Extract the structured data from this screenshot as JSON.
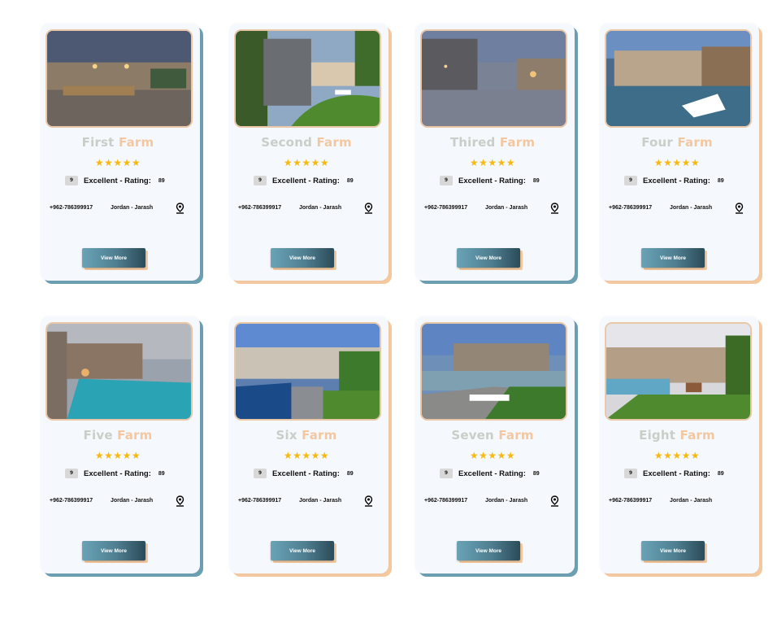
{
  "colors": {
    "shadow_blue": "#6c9fb2",
    "shadow_peach": "#f4c9a0",
    "title_gray": "#c9cec8",
    "title_accent": "#f2c8a2",
    "star_gold": "#f6b90f",
    "button_gradient": [
      "#6aa3b6",
      "#2b4b58"
    ]
  },
  "cards": [
    {
      "title_first": "First",
      "title_accent": "Farm",
      "stars": "★★★★★",
      "score": "9",
      "rating_label": "Excellent - Rating:",
      "rating_value": "89",
      "phone": "+962-786399917",
      "location": "Jordan - Jarash",
      "pin_icon": "location-pin-icon",
      "button_label": "View More",
      "shadow": "blue"
    },
    {
      "title_first": "Second",
      "title_accent": "Farm",
      "stars": "★★★★★",
      "score": "9",
      "rating_label": "Excellent - Rating:",
      "rating_value": "89",
      "phone": "+962-786399917",
      "location": "Jordan - Jarash",
      "pin_icon": "location-pin-icon",
      "button_label": "View More",
      "shadow": "peach"
    },
    {
      "title_first": "Thired",
      "title_accent": "Farm",
      "stars": "★★★★★",
      "score": "9",
      "rating_label": "Excellent - Rating:",
      "rating_value": "89",
      "phone": "+962-786399917",
      "location": "Jordan - Jarash",
      "pin_icon": "location-pin-icon",
      "button_label": "View More",
      "shadow": "blue"
    },
    {
      "title_first": "Four",
      "title_accent": "Farm",
      "stars": "★★★★★",
      "score": "9",
      "rating_label": "Excellent - Rating:",
      "rating_value": "89",
      "phone": "+962-786399917",
      "location": "Jordan - Jarash",
      "pin_icon": "location-pin-icon",
      "button_label": "View More",
      "shadow": "peach"
    },
    {
      "title_first": "Five",
      "title_accent": "Farm",
      "stars": "★★★★★",
      "score": "9",
      "rating_label": "Excellent - Rating:",
      "rating_value": "89",
      "phone": "+962-786399917",
      "location": "Jordan - Jarash",
      "pin_icon": "location-pin-icon",
      "button_label": "View More",
      "shadow": "blue"
    },
    {
      "title_first": "Six",
      "title_accent": "Farm",
      "stars": "★★★★★",
      "score": "9",
      "rating_label": "Excellent - Rating:",
      "rating_value": "89",
      "phone": "+962-786399917",
      "location": "Jordan - Jarash",
      "pin_icon": "location-pin-icon",
      "button_label": "View More",
      "shadow": "peach"
    },
    {
      "title_first": "Seven",
      "title_accent": "Farm",
      "stars": "★★★★★",
      "score": "9",
      "rating_label": "Excellent - Rating:",
      "rating_value": "89",
      "phone": "+962-786399917",
      "location": "Jordan - Jarash",
      "pin_icon": "location-pin-icon",
      "button_label": "View More",
      "shadow": "blue"
    },
    {
      "title_first": "Eight",
      "title_accent": "Farm",
      "stars": "★★★★★",
      "score": "9",
      "rating_label": "Excellent - Rating:",
      "rating_value": "89",
      "phone": "+962-786399917",
      "location": "Jordan - Jarash",
      "pin_icon": "",
      "button_label": "View More",
      "shadow": "peach"
    }
  ]
}
